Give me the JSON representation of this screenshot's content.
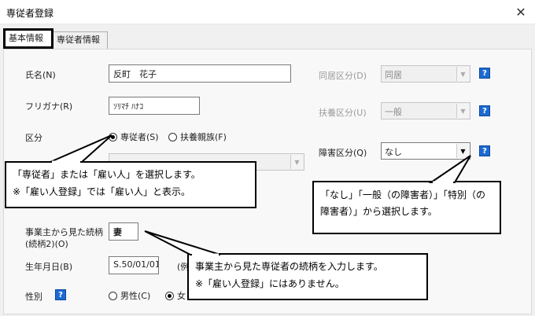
{
  "window": {
    "title": "専従者登録",
    "close_glyph": "✕"
  },
  "tabs": [
    {
      "label": "基本情報",
      "active": true
    },
    {
      "label": "専従者情報",
      "active": false
    }
  ],
  "form": {
    "name_label": "氏名(N)",
    "name_value": "反町　花子",
    "kana_label": "フリガナ(R)",
    "kana_value": "ｿﾘﾏﾁ ﾊﾅｺ",
    "kubun_label": "区分",
    "kubun_options": [
      "専従者(S)",
      "扶養親族(F)"
    ],
    "kubun_selected": "専従者(S)",
    "relation_label_line1": "事業主から見た続柄",
    "relation_label_line2": "(続柄2)(O)",
    "relation_value": "妻",
    "birth_label": "生年月日(B)",
    "birth_value": "S.50/01/01",
    "birth_hint": "(例",
    "sex_label": "性別",
    "sex_options": [
      "男性(C)",
      "女"
    ],
    "sex_selected": "女",
    "doukyo_label": "同居区分(D)",
    "doukyo_value": "同居",
    "fuyou_label": "扶養区分(U)",
    "fuyou_value": "一般",
    "shougai_label": "障害区分(Q)",
    "shougai_value": "なし",
    "help_glyph": "?"
  },
  "callouts": {
    "kubun": [
      "「専従者」または「雇い人」を選択します。",
      "※「雇い人登録」では「雇い人」と表示。"
    ],
    "shougai": [
      "「なし」「一般（の障害者）」「特別（の",
      "障害者）」から選択します。"
    ],
    "relation": [
      "事業主から見た専従者の続柄を入力します。",
      "※「雇い人登録」にはありません。"
    ]
  },
  "colors": {
    "help_icon": "#1c6ad1",
    "tab_highlight": "#000000"
  }
}
